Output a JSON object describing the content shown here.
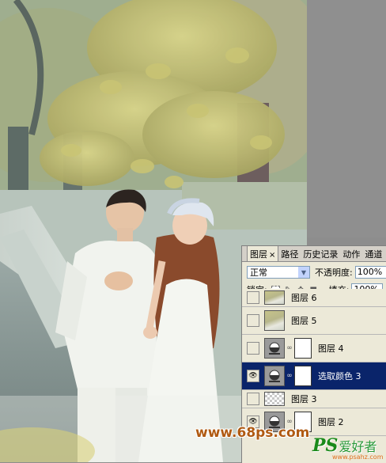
{
  "panel": {
    "tabs": [
      {
        "label": "图层",
        "active": true
      },
      {
        "label": "路径",
        "active": false
      },
      {
        "label": "历史记录",
        "active": false
      },
      {
        "label": "动作",
        "active": false
      },
      {
        "label": "通道",
        "active": false
      }
    ],
    "tab_close": "×",
    "blend_mode": "正常",
    "opacity_label": "不透明度:",
    "opacity_value": "100%",
    "lock_label": "锁定:",
    "fill_label": "填充:",
    "fill_value": "100%"
  },
  "layers": [
    {
      "name": "图层 6",
      "visible": false,
      "type": "photo",
      "selected": false
    },
    {
      "name": "图层 5",
      "visible": false,
      "type": "photo",
      "selected": false
    },
    {
      "name": "图层 4",
      "visible": false,
      "type": "adjustment",
      "selected": false
    },
    {
      "name": "选取颜色 3",
      "visible": true,
      "type": "adjustment",
      "selected": true
    },
    {
      "name": "图层 3",
      "visible": false,
      "type": "checker",
      "selected": false
    },
    {
      "name": "图层 2",
      "visible": true,
      "type": "adjustment",
      "selected": false
    }
  ],
  "watermarks": {
    "site": "www.68ps.com",
    "brand_ps": "PS",
    "brand_cn": "爱好者",
    "brand_url": "www.psahz.com"
  },
  "colors": {
    "selected_row": "#0a246a",
    "panel_bg": "#ece9d8",
    "watermark_orange": "#b05a12",
    "watermark_green": "#1a8a1a"
  }
}
